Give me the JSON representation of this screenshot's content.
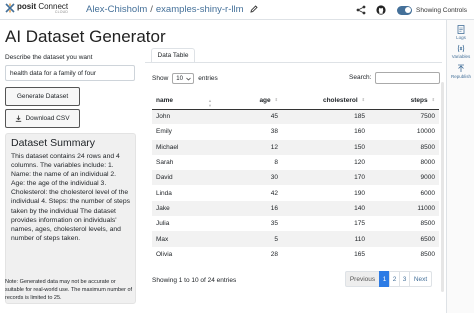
{
  "topbar": {
    "brand_main_bold": "posit",
    "brand_main": " Connect",
    "brand_sub": "CLOUD",
    "owner": "Alex-Chisholm",
    "separator": "/",
    "app_name": "examples-shiny-r-llm",
    "toggle_label": "Showing Controls",
    "toggle_on": true
  },
  "rail": {
    "logs": "Logs",
    "variables": "Variables",
    "republish": "Republish"
  },
  "app": {
    "title": "AI Dataset Generator",
    "prompt_label": "Describe the dataset you want",
    "prompt_value": "health data for a family of four",
    "generate_label": "Generate Dataset",
    "download_label": "Download CSV",
    "summary_title": "Dataset Summary",
    "summary_text": "This dataset contains 24 rows and 4 columns. The variables include: 1. Name: the name of an individual 2. Age: the age of the individual 3. Cholesterol: the cholesterol level of the individual 4. Steps: the number of steps taken by the individual The dataset provides information on individuals' names, ages, cholesterol levels, and number of steps taken.",
    "note": "Note: Generated data may not be accurate or suitable for real-world use. The maximum number of records is limited to 25."
  },
  "table_panel": {
    "tab_label": "Data Table",
    "show_label": "Show",
    "page_length": "10",
    "entries_label": "entries",
    "search_label": "Search:",
    "columns": [
      "name",
      "age",
      "cholesterol",
      "steps"
    ],
    "rows": [
      [
        "John",
        "45",
        "185",
        "7500"
      ],
      [
        "Emily",
        "38",
        "160",
        "10000"
      ],
      [
        "Michael",
        "12",
        "150",
        "8500"
      ],
      [
        "Sarah",
        "8",
        "120",
        "8000"
      ],
      [
        "David",
        "30",
        "170",
        "9000"
      ],
      [
        "Linda",
        "42",
        "190",
        "6000"
      ],
      [
        "Jake",
        "16",
        "140",
        "11000"
      ],
      [
        "Julia",
        "35",
        "175",
        "8500"
      ],
      [
        "Max",
        "5",
        "110",
        "6500"
      ],
      [
        "Olivia",
        "28",
        "165",
        "8500"
      ]
    ],
    "info": "Showing 1 to 10 of 24 entries",
    "pagination": {
      "previous": "Previous",
      "pages": [
        "1",
        "2",
        "3"
      ],
      "active_page": "1",
      "next": "Next"
    }
  },
  "colors": {
    "accent": "#447099",
    "active_page": "#2c7be5",
    "summary_bg": "#f0f0f0"
  },
  "icons": [
    "posit-logo-icon",
    "pencil-icon",
    "share-icon",
    "github-icon",
    "logs-icon",
    "variables-icon",
    "republish-icon",
    "download-icon",
    "sort-icon",
    "chevron-down-icon"
  ]
}
